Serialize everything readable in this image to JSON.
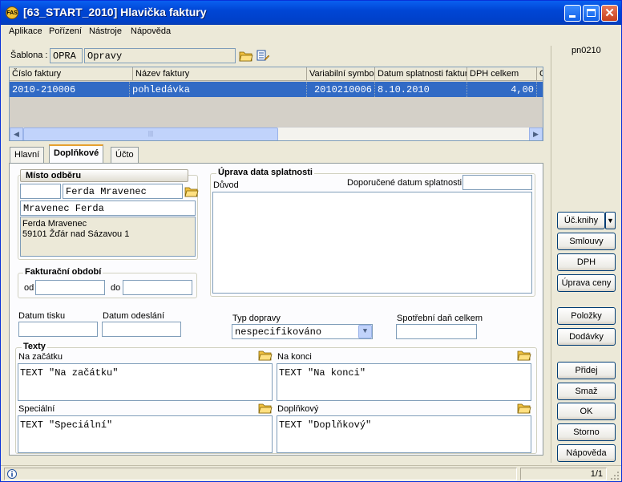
{
  "window": {
    "title": "[63_START_2010] Hlavička faktury",
    "app_icon_label": "FAS"
  },
  "menu": [
    "Aplikace",
    "Pořízení",
    "Nástroje",
    "Nápověda"
  ],
  "template": {
    "label": "Šablona :",
    "code": "OPRA",
    "name": "Opravy"
  },
  "form_id": "pn0210",
  "grid": {
    "columns": [
      "Číslo faktury",
      "Název faktury",
      "Variabilní symbol",
      "Datum splatnosti faktury",
      "DPH celkem",
      "C"
    ],
    "rows": [
      [
        "2010-210006",
        "pohledávka",
        "2010210006",
        "8.10.2010",
        "4,00",
        ""
      ]
    ]
  },
  "tabs": [
    {
      "label": "Hlavní",
      "active": false
    },
    {
      "label": "Doplňkové",
      "active": true
    },
    {
      "label": "Účto",
      "active": false
    }
  ],
  "misto_odberu": {
    "title": "Místo odběru",
    "code": "",
    "short_name": "Ferda Mravenec",
    "name": "Mravenec Ferda",
    "address_line1": "Ferda Mravenec",
    "address_line2": "59101   Žďár nad Sázavou 1"
  },
  "fakturacni_obdobi": {
    "title": "Fakturační období",
    "od_label": "od",
    "od_value": "",
    "do_label": "do",
    "do_value": ""
  },
  "uprava_data": {
    "title": "Úprava data splatnosti",
    "duvod_label": "Důvod",
    "doporucene_label": "Doporučené datum splatnosti",
    "doporucene_value": "",
    "duvod_value": ""
  },
  "dates": {
    "datum_tisku_label": "Datum tisku",
    "datum_tisku_value": "",
    "datum_odeslani_label": "Datum odeslání",
    "datum_odeslani_value": ""
  },
  "typ_dopravy": {
    "label": "Typ dopravy",
    "value": "nespecifikováno"
  },
  "spotrebni_dan": {
    "label": "Spotřební daň celkem",
    "value": ""
  },
  "texty": {
    "title": "Texty",
    "na_zacatku_label": "Na začátku",
    "na_zacatku_value": "TEXT \"Na začátku\"",
    "na_konci_label": "Na konci",
    "na_konci_value": "TEXT \"Na konci\"",
    "specialni_label": "Speciální",
    "specialni_value": "TEXT \"Speciální\"",
    "doplnkovy_label": "Doplňkový",
    "doplnkovy_value": "TEXT \"Doplňkový\""
  },
  "buttons": {
    "uc_knihy": "Úč.knihy",
    "smlouvy": "Smlouvy",
    "dph": "DPH",
    "uprava_ceny": "Úprava ceny",
    "polozky": "Položky",
    "dodavky": "Dodávky",
    "pridej": "Přidej",
    "smaz": "Smaž",
    "ok": "OK",
    "storno": "Storno",
    "napoveda": "Nápověda"
  },
  "status": {
    "pages": "1/1"
  },
  "icons": {
    "folder_color": "#f0c040",
    "accent_color": "#316ac5"
  }
}
